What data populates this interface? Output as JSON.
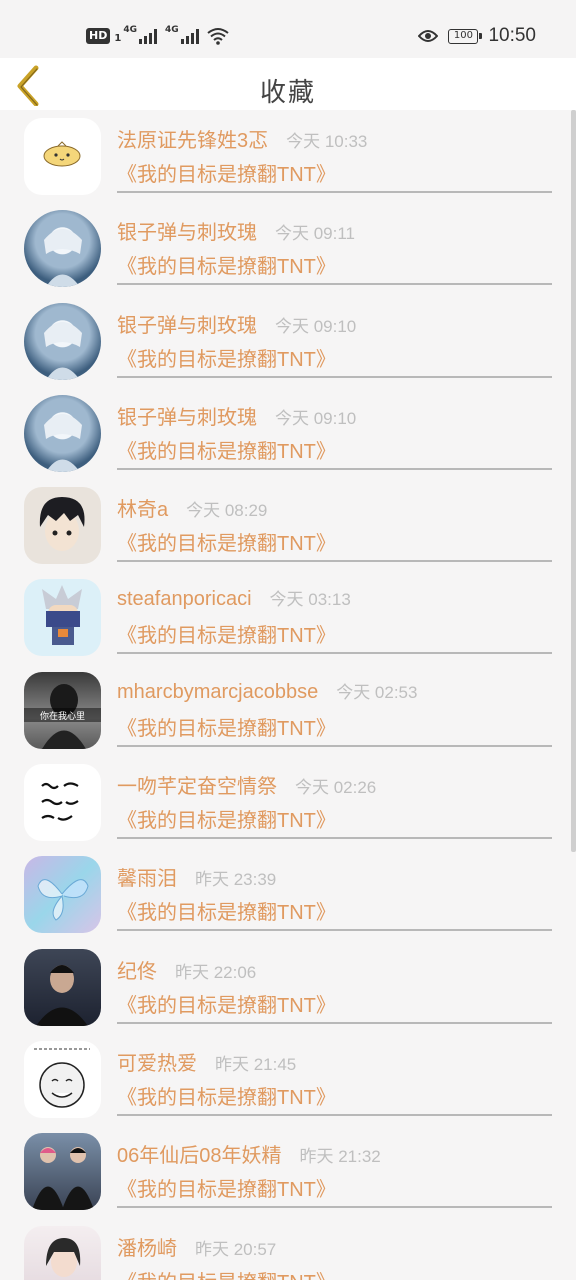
{
  "status_bar": {
    "hd": "HD",
    "hd_sub": "1",
    "net1": "4G",
    "net2": "4G",
    "battery": "100",
    "time": "10:50"
  },
  "header": {
    "title": "收藏"
  },
  "icons": {
    "back": "chevron-left-icon",
    "eye": "eye-icon",
    "wifi": "wifi-icon"
  },
  "colors": {
    "accent": "#e09a60",
    "time": "#bfbfbf",
    "back": "#c9a227"
  },
  "items": [
    {
      "name": "法原证先锋姓3忑",
      "time": "今天 10:33",
      "message": "《我的目标是撩翻TNT》"
    },
    {
      "name": "银子弹与刺玫瑰",
      "time": "今天 09:11",
      "message": "《我的目标是撩翻TNT》"
    },
    {
      "name": "银子弹与刺玫瑰",
      "time": "今天 09:10",
      "message": "《我的目标是撩翻TNT》"
    },
    {
      "name": "银子弹与刺玫瑰",
      "time": "今天 09:10",
      "message": "《我的目标是撩翻TNT》"
    },
    {
      "name": "林奇a",
      "time": "今天 08:29",
      "message": "《我的目标是撩翻TNT》"
    },
    {
      "name": "steafanporicaci",
      "time": "今天 03:13",
      "message": "《我的目标是撩翻TNT》"
    },
    {
      "name": "mharcbymarcjacobbse",
      "time": "今天 02:53",
      "message": "《我的目标是撩翻TNT》",
      "avatar_text": "你在我心里"
    },
    {
      "name": "一吻芊定奋空情祭",
      "time": "今天 02:26",
      "message": "《我的目标是撩翻TNT》"
    },
    {
      "name": "馨雨泪",
      "time": "昨天 23:39",
      "message": "《我的目标是撩翻TNT》"
    },
    {
      "name": "纪佟",
      "time": "昨天 22:06",
      "message": "《我的目标是撩翻TNT》"
    },
    {
      "name": "可爱热爱",
      "time": "昨天 21:45",
      "message": "《我的目标是撩翻TNT》"
    },
    {
      "name": "06年仙后08年妖精",
      "time": "昨天 21:32",
      "message": "《我的目标是撩翻TNT》"
    },
    {
      "name": "潘杨崎",
      "time": "昨天 20:57",
      "message": "《我的目标是撩翻TNT》"
    }
  ]
}
